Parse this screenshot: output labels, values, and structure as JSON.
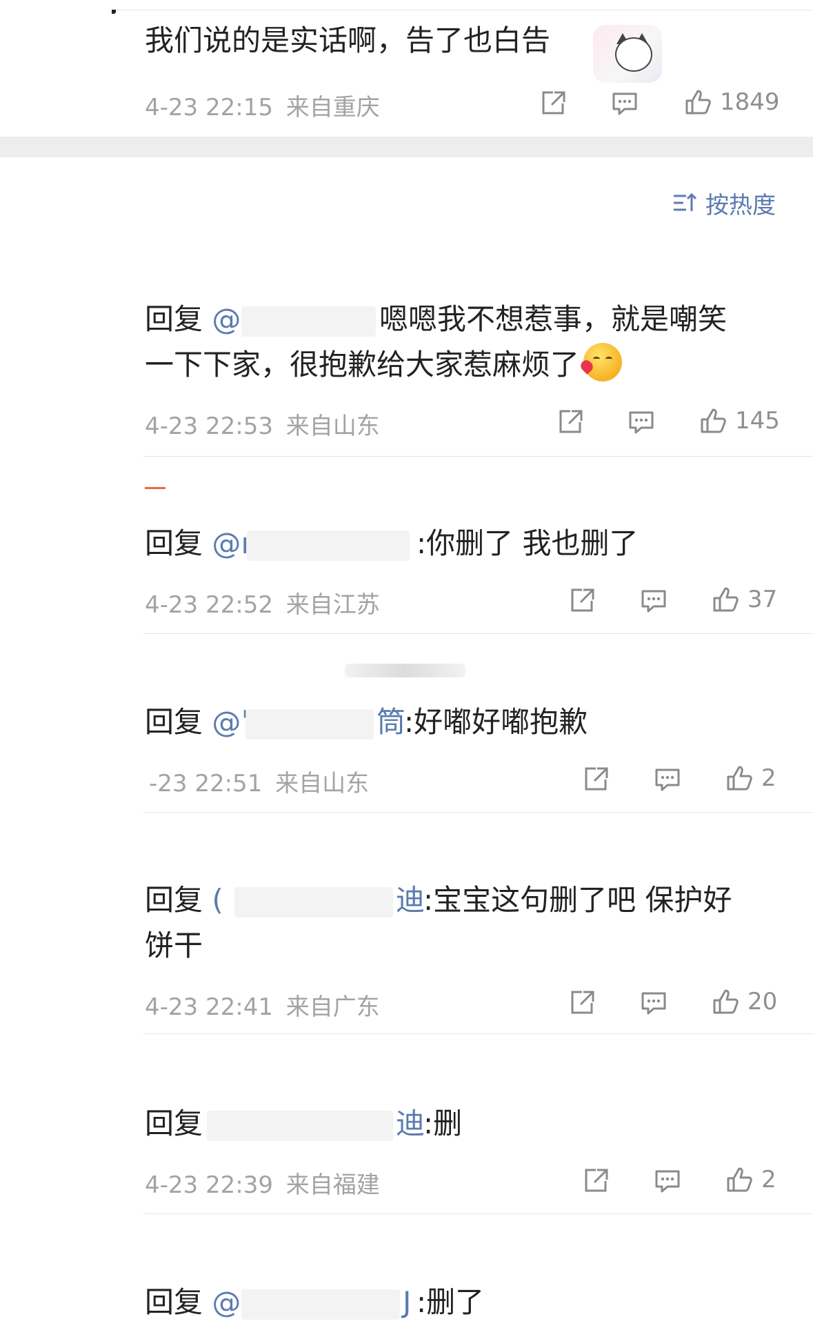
{
  "top_comment": {
    "text": "我们说的是实话啊，告了也白告",
    "time": "4-23 22:15",
    "location": "来自重庆",
    "likes": "1849"
  },
  "sort": {
    "label": "按热度",
    "icon": "sort-hot-icon"
  },
  "replies": [
    {
      "prefix": "回复",
      "mention": "@",
      "text_line1": "嗯嗯我不想惹事，就是嘲笑",
      "text_line2": "一下下家，很抱歉给大家惹麻烦了",
      "time": "4-23 22:53",
      "location": "来自山东",
      "likes": "145"
    },
    {
      "prefix": "回复",
      "mention": "@ı",
      "text_line1": ":你删了 我也删了",
      "time": "4-23 22:52",
      "location": "来自江苏",
      "likes": "37"
    },
    {
      "prefix": "回复",
      "mention": "@ˈ",
      "mention_tail": "筒",
      "text_line1": ":好嘟好嘟抱歉",
      "time": "-23 22:51",
      "location": "来自山东",
      "likes": "2"
    },
    {
      "prefix": "回复",
      "mention": "(",
      "mention_tail": "迪",
      "text_line1": ":宝宝这句删了吧 保护好",
      "text_line2": "饼干",
      "time": "4-23 22:41",
      "location": "来自广东",
      "likes": "20"
    },
    {
      "prefix": "回复",
      "mention_tail": "迪",
      "text_line1": ":删",
      "time": "4-23 22:39",
      "location": "来自福建",
      "likes": "2"
    },
    {
      "prefix": "回复",
      "mention": "@",
      "mention_tail": "J",
      "text_line1": ":删了"
    }
  ],
  "colors": {
    "link": "#5b7bb0",
    "meta": "#a3a3a3",
    "divider": "#e4e4e4",
    "band": "#ededed"
  }
}
